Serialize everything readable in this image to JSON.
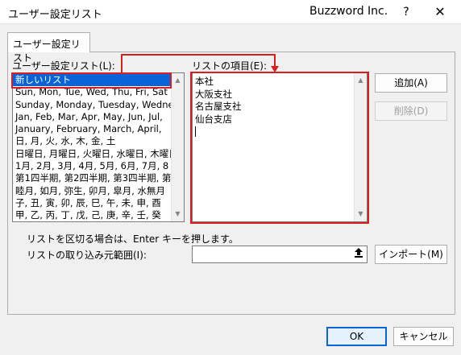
{
  "window": {
    "title": "ユーザー設定リスト",
    "brand": "Buzzword Inc.",
    "help_glyph": "?",
    "close_glyph": "✕"
  },
  "tab": {
    "label": "ユーザー設定リスト"
  },
  "custom_lists": {
    "label": "ユーザー設定リスト(L):",
    "items": [
      "新しいリスト",
      "Sun, Mon, Tue, Wed, Thu, Fri, Sat",
      "Sunday, Monday, Tuesday, Wednesday",
      "Jan, Feb, Mar, Apr, May, Jun, Jul,",
      "January, February, March, April,",
      "日, 月, 火, 水, 木, 金, 土",
      "日曜日, 月曜日, 火曜日, 水曜日, 木曜日",
      "1月, 2月, 3月, 4月, 5月, 6月, 7月, 8",
      "第1四半期, 第2四半期, 第3四半期, 第",
      "睦月, 如月, 弥生, 卯月, 皐月, 水無月",
      "子, 丑, 寅, 卯, 辰, 巳, 午, 未, 申, 酉",
      "甲, 乙, 丙, 丁, 戊, 己, 庚, 辛, 壬, 癸"
    ]
  },
  "list_entries": {
    "label": "リストの項目(E):",
    "lines": [
      "本社",
      "大阪支社",
      "名古屋支社",
      "仙台支店"
    ]
  },
  "buttons": {
    "add": "追加(A)",
    "delete": "削除(D)",
    "import": "インポート(M)",
    "ok": "OK",
    "cancel": "キャンセル"
  },
  "hint": "リストを区切る場合は、Enter キーを押します。",
  "import_range": {
    "label": "リストの取り込み元範囲(I):",
    "value": ""
  },
  "colors": {
    "highlight_red": "#d81f1f",
    "selection_blue": "#0a64d8"
  }
}
